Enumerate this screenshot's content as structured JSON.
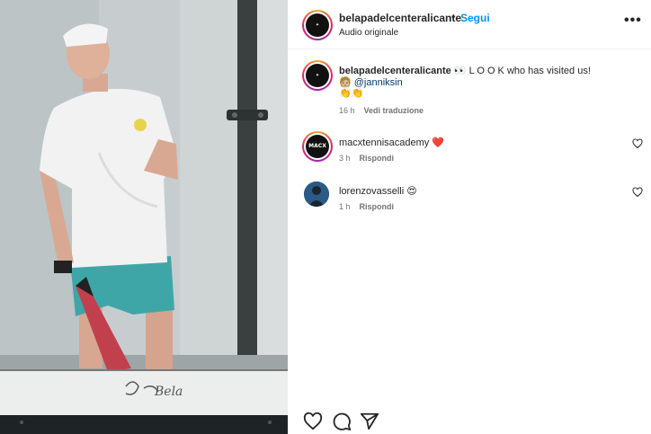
{
  "post": {
    "account": {
      "username": "belapadelcenteralicante",
      "separator": "•",
      "follow_label": "Segui",
      "audio_label": "Audio originale",
      "more_label": "•••"
    },
    "media": {
      "alt": "Video: tennis player in white t-shirt and cap holding a padel racket on an indoor court",
      "board_signature": "Bela"
    },
    "caption": {
      "username": "belapadelcenteralicante",
      "emoji_eyes": "👀",
      "text": "L O O K who has visited us!",
      "emoji_person": "🧑🏼",
      "mention": "@janniksin",
      "emoji_clap": "👏👏",
      "time": "16 h",
      "translate_label": "Vedi traduzione"
    },
    "comments": [
      {
        "username": "macxtennisacademy",
        "emoji": "❤️",
        "time": "3 h",
        "reply_label": "Rispondi",
        "avatar_text": "MACX TENNIS"
      },
      {
        "username": "lorenzovasselli",
        "emoji": "😍",
        "time": "1 h",
        "reply_label": "Rispondi"
      }
    ],
    "actions": [
      {
        "icon": "heart-icon"
      },
      {
        "icon": "comment-icon"
      },
      {
        "icon": "share-icon"
      }
    ]
  },
  "colors": {
    "link_blue": "#0095f6",
    "mention_blue": "#00376b",
    "text_primary": "#262626",
    "text_secondary": "#737373",
    "heart_red": "#e0245e"
  }
}
